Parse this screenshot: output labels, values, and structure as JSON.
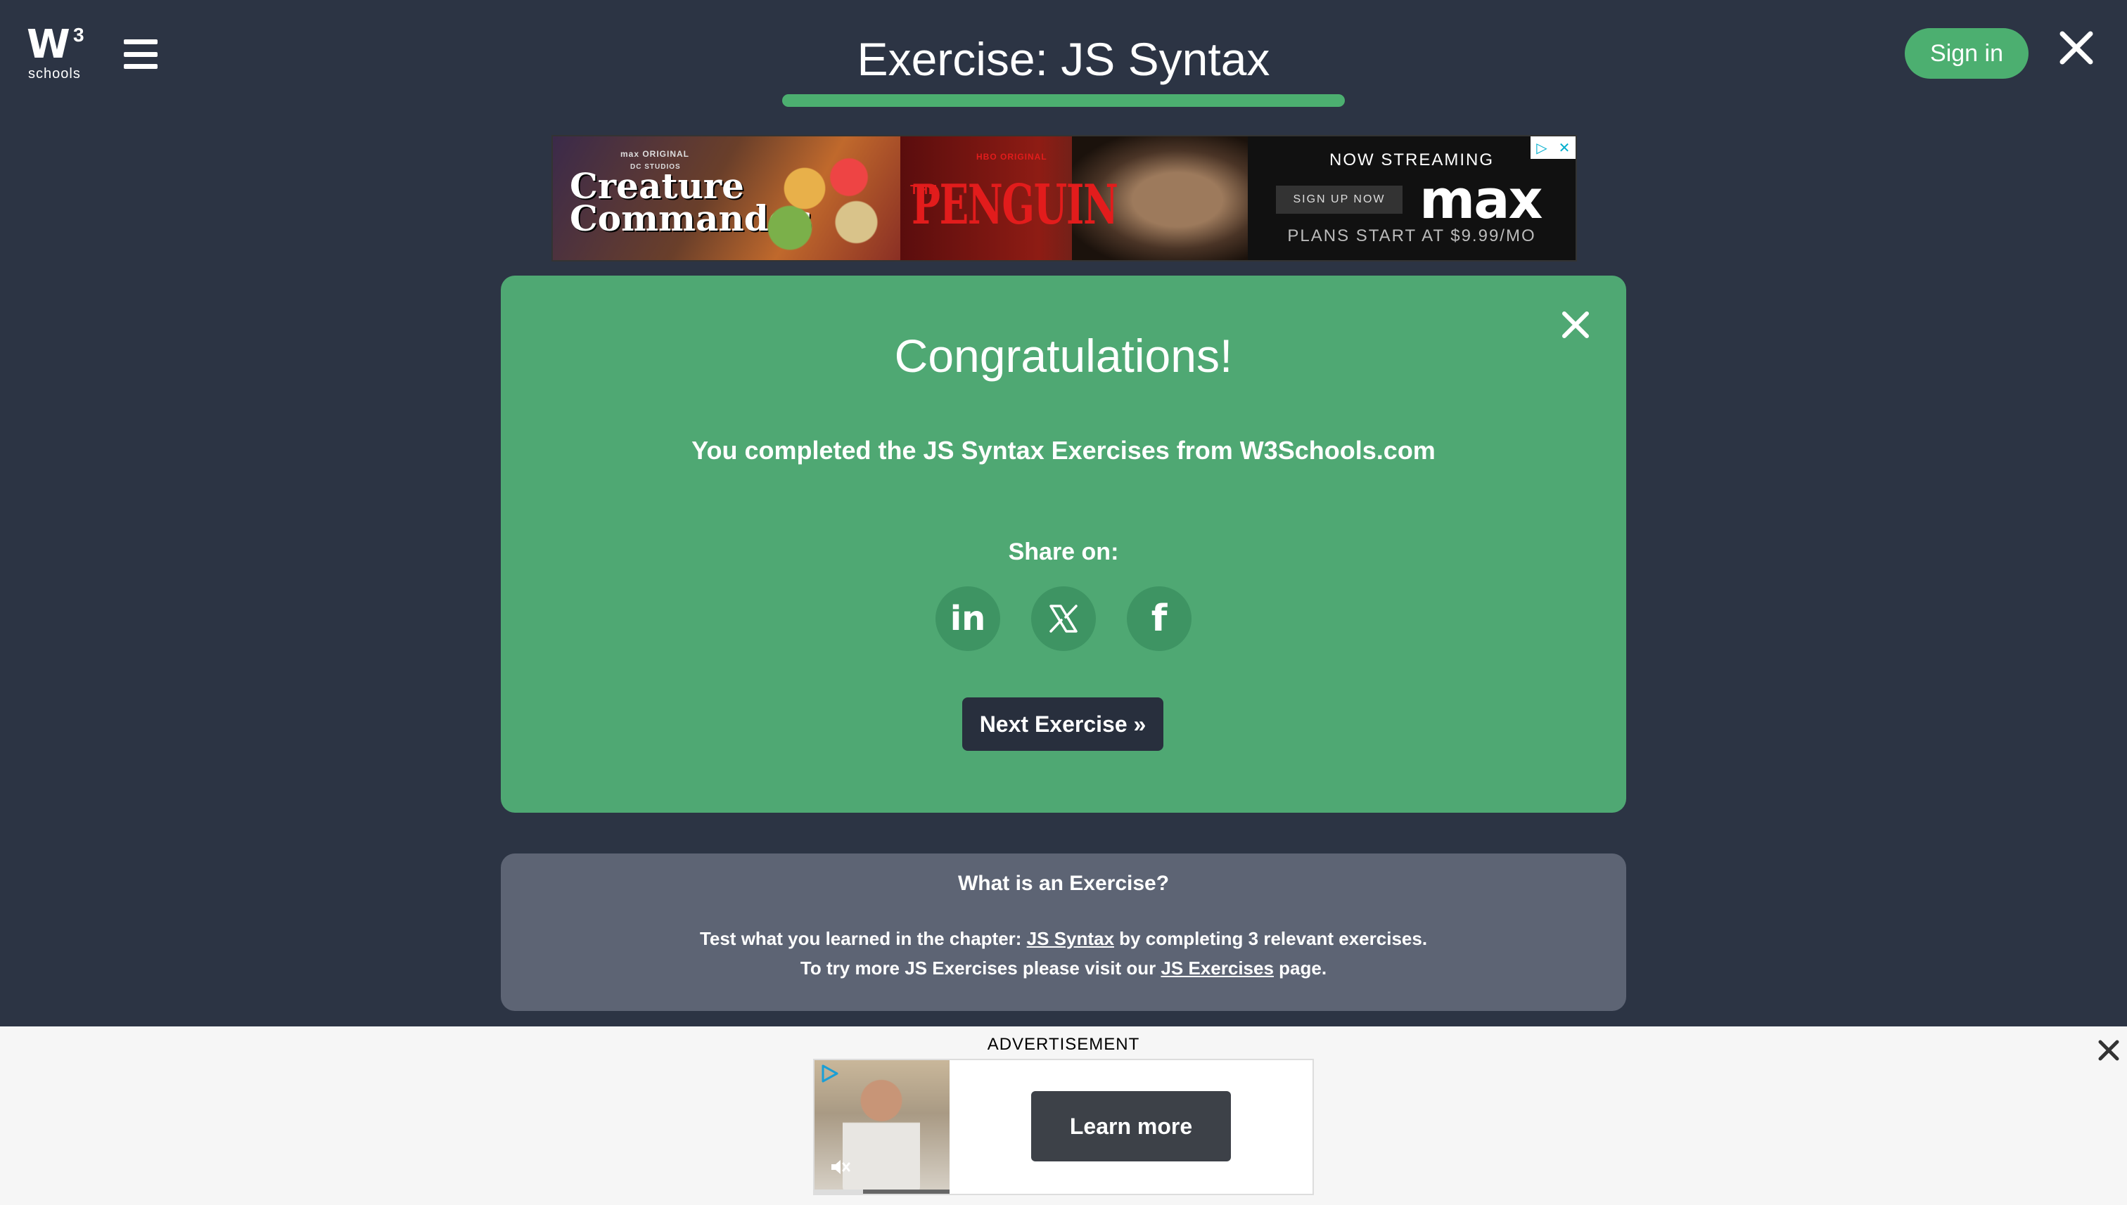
{
  "header": {
    "logo": {
      "main": "W",
      "sup": "3",
      "sub": "schools"
    },
    "menu_icon": "hamburger-icon",
    "title": "Exercise: JS Syntax",
    "progress_percent": 100,
    "signin_label": "Sign in",
    "close_icon": "close-icon"
  },
  "top_ad": {
    "creature": {
      "brand": "max ORIGINAL",
      "studio": "DC STUDIOS",
      "title_line1": "Creature",
      "title_line2": "Commandos"
    },
    "penguin": {
      "brand": "HBO ORIGINAL",
      "prefix": "THE",
      "title": "PENGUIN"
    },
    "max": {
      "now": "NOW STREAMING",
      "signup": "SIGN UP NOW",
      "logo": "max",
      "plans": "PLANS START AT $9.99/MO"
    },
    "adchoices_icons": [
      "adchoices-icon",
      "close-icon"
    ]
  },
  "congrats": {
    "title": "Congratulations!",
    "message": "You completed the JS Syntax Exercises from W3Schools.com",
    "share_label": "Share on:",
    "share_icons": [
      "linkedin-icon",
      "x-icon",
      "facebook-icon"
    ],
    "linkedin_text": "in",
    "facebook_text": "f",
    "next_label": "Next Exercise »"
  },
  "info": {
    "title": "What is an Exercise?",
    "line1_pre": "Test what you learned in the chapter: ",
    "line1_link": "JS Syntax",
    "line1_post": " by completing 3 relevant exercises.",
    "line2_pre": "To try more JS Exercises please visit our ",
    "line2_link": "JS Exercises",
    "line2_post": " page."
  },
  "bottom_ad": {
    "label": "ADVERTISEMENT",
    "cta": "Learn more",
    "video_progress": 0.36
  },
  "colors": {
    "background": "#2c3444",
    "accent_green": "#4caf70",
    "card_green": "#4fa873",
    "info_gray": "#5d6474",
    "dark_button": "#282f3d"
  }
}
